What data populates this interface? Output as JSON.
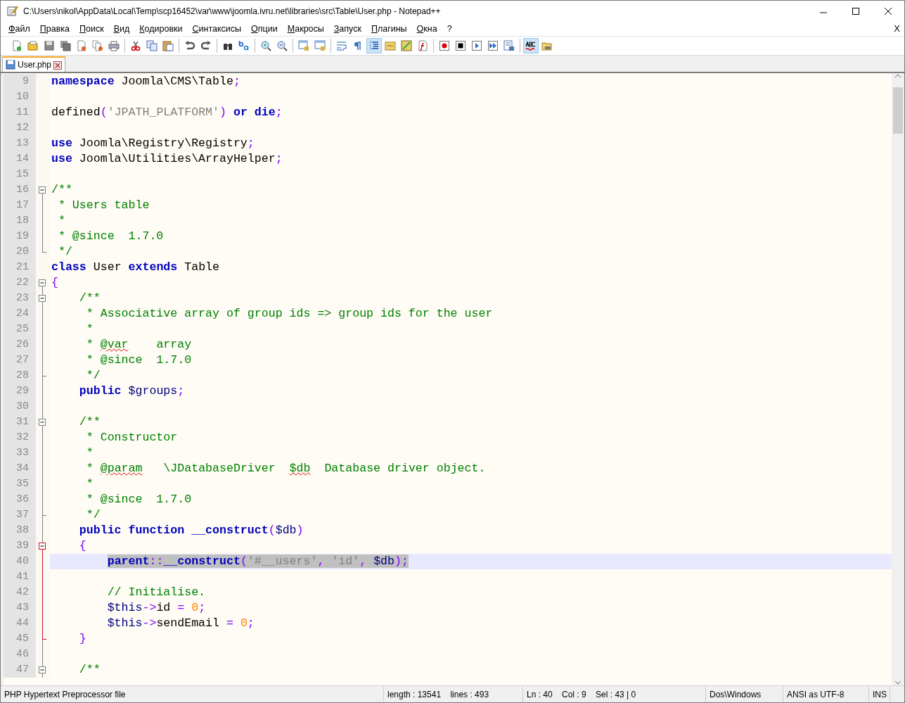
{
  "window": {
    "title": "C:\\Users\\nikol\\AppData\\Local\\Temp\\scp16452\\var\\www\\joomla.ivru.net\\libraries\\src\\Table\\User.php - Notepad++"
  },
  "menu": [
    "Файл",
    "Правка",
    "Поиск",
    "Вид",
    "Кодировки",
    "Синтаксисы",
    "Опции",
    "Макросы",
    "Запуск",
    "Плагины",
    "Окна",
    "?"
  ],
  "menu_close": "X",
  "toolbar": [
    {
      "kind": "new",
      "pressed": false
    },
    {
      "kind": "open",
      "pressed": false
    },
    {
      "kind": "save",
      "pressed": false
    },
    {
      "kind": "save-all",
      "pressed": false
    },
    {
      "kind": "close",
      "pressed": false
    },
    {
      "kind": "close-all",
      "pressed": false
    },
    {
      "kind": "print",
      "pressed": false
    },
    {
      "kind": "separator"
    },
    {
      "kind": "cut",
      "pressed": false
    },
    {
      "kind": "copy",
      "pressed": false
    },
    {
      "kind": "paste",
      "pressed": false
    },
    {
      "kind": "separator"
    },
    {
      "kind": "undo",
      "pressed": false
    },
    {
      "kind": "redo",
      "pressed": false
    },
    {
      "kind": "separator"
    },
    {
      "kind": "find",
      "pressed": false
    },
    {
      "kind": "replace",
      "pressed": false
    },
    {
      "kind": "separator"
    },
    {
      "kind": "zoom-in",
      "pressed": false
    },
    {
      "kind": "zoom-out",
      "pressed": false
    },
    {
      "kind": "separator"
    },
    {
      "kind": "sync-vertical",
      "pressed": false
    },
    {
      "kind": "sync-horizontal",
      "pressed": false
    },
    {
      "kind": "separator"
    },
    {
      "kind": "word-wrap",
      "pressed": false
    },
    {
      "kind": "show-symbols",
      "pressed": false
    },
    {
      "kind": "indent-guide",
      "pressed": true
    },
    {
      "kind": "language",
      "pressed": false
    },
    {
      "kind": "document-map",
      "pressed": false
    },
    {
      "kind": "function-list",
      "pressed": false
    },
    {
      "kind": "separator"
    },
    {
      "kind": "record",
      "pressed": false
    },
    {
      "kind": "stop",
      "pressed": false
    },
    {
      "kind": "play",
      "pressed": false
    },
    {
      "kind": "play-multiple",
      "pressed": false
    },
    {
      "kind": "save-macro",
      "pressed": false
    },
    {
      "kind": "separator"
    },
    {
      "kind": "spellcheck",
      "pressed": true
    },
    {
      "kind": "folder",
      "pressed": false
    }
  ],
  "tabs": [
    {
      "label": "User.php",
      "selected": true
    }
  ],
  "code": {
    "lines": [
      {
        "number": "9",
        "fold_start": false,
        "fold_end": false,
        "current": false,
        "selected": false,
        "tokens": [
          {
            "kind": "kw",
            "text": "namespace"
          },
          {
            "kind": "text",
            "text": " Joomla\\CMS\\Table"
          },
          {
            "kind": "op",
            "text": ";"
          }
        ]
      },
      {
        "number": "10",
        "fold_start": false,
        "fold_end": false,
        "current": false,
        "selected": false
      },
      {
        "number": "11",
        "fold_start": false,
        "fold_end": false,
        "current": false,
        "selected": false,
        "tokens": [
          {
            "kind": "text",
            "text": "defined"
          },
          {
            "kind": "op",
            "text": "("
          },
          {
            "kind": "str",
            "text": "'JPATH_PLATFORM'"
          },
          {
            "kind": "op",
            "text": ") "
          },
          {
            "kind": "kw",
            "text": "or "
          },
          {
            "kind": "kw",
            "text": "die"
          },
          {
            "kind": "op",
            "text": ";"
          }
        ]
      },
      {
        "number": "12",
        "fold_start": false,
        "fold_end": false,
        "current": false,
        "selected": false
      },
      {
        "number": "13",
        "fold_start": false,
        "fold_end": false,
        "current": false,
        "selected": false,
        "tokens": [
          {
            "kind": "kw",
            "text": "use"
          },
          {
            "kind": "text",
            "text": " Joomla\\Registry\\Registry"
          },
          {
            "kind": "op",
            "text": ";"
          }
        ]
      },
      {
        "number": "14",
        "fold_start": false,
        "fold_end": false,
        "current": false,
        "selected": false,
        "tokens": [
          {
            "kind": "kw",
            "text": "use"
          },
          {
            "kind": "text",
            "text": " Joomla\\Utilities\\ArrayHelper"
          },
          {
            "kind": "op",
            "text": ";"
          }
        ]
      },
      {
        "number": "15",
        "fold_start": false,
        "fold_end": false,
        "current": false,
        "selected": false
      },
      {
        "number": "16",
        "fold_start": true,
        "fold_end": false,
        "current": false,
        "selected": false,
        "tokens": [
          {
            "kind": "com",
            "text": "/**"
          }
        ]
      },
      {
        "number": "17",
        "fold_start": false,
        "fold_end": false,
        "current": false,
        "selected": false,
        "tokens": [
          {
            "kind": "com",
            "text": " * Users table"
          }
        ]
      },
      {
        "number": "18",
        "fold_start": false,
        "fold_end": false,
        "current": false,
        "selected": false,
        "tokens": [
          {
            "kind": "com",
            "text": " *"
          }
        ]
      },
      {
        "number": "19",
        "fold_start": false,
        "fold_end": false,
        "current": false,
        "selected": false,
        "tokens": [
          {
            "kind": "com",
            "text": " * @since  1.7.0"
          }
        ]
      },
      {
        "number": "20",
        "fold_start": false,
        "fold_end": true,
        "current": false,
        "selected": false,
        "tokens": [
          {
            "kind": "com",
            "text": " */"
          }
        ]
      },
      {
        "number": "21",
        "fold_start": false,
        "fold_end": false,
        "current": false,
        "selected": false,
        "tokens": [
          {
            "kind": "kw",
            "text": "class"
          },
          {
            "kind": "text",
            "text": " User "
          },
          {
            "kind": "kw",
            "text": "extends"
          },
          {
            "kind": "text",
            "text": " Table"
          }
        ]
      },
      {
        "number": "22",
        "fold_start": true,
        "fold_end": false,
        "current": false,
        "selected": false,
        "tokens": [
          {
            "kind": "op",
            "text": "{"
          }
        ]
      },
      {
        "number": "23",
        "fold_start": true,
        "fold_end": false,
        "current": false,
        "selected": false,
        "tokens": [
          {
            "kind": "com",
            "text": "    /**"
          }
        ]
      },
      {
        "number": "24",
        "fold_start": false,
        "fold_end": false,
        "current": false,
        "selected": false,
        "tokens": [
          {
            "kind": "com",
            "text": "     * Associative array of group ids => group ids for the user"
          }
        ]
      },
      {
        "number": "25",
        "fold_start": false,
        "fold_end": false,
        "current": false,
        "selected": false,
        "tokens": [
          {
            "kind": "com",
            "text": "     *"
          }
        ]
      },
      {
        "number": "26",
        "fold_start": false,
        "fold_end": false,
        "current": false,
        "selected": false,
        "tokens": [
          {
            "kind": "com",
            "text": "     * "
          },
          {
            "kind": "err",
            "text": "@var"
          },
          {
            "kind": "com",
            "text": "    array"
          }
        ]
      },
      {
        "number": "27",
        "fold_start": false,
        "fold_end": false,
        "current": false,
        "selected": false,
        "tokens": [
          {
            "kind": "com",
            "text": "     * @since  1.7.0"
          }
        ]
      },
      {
        "number": "28",
        "fold_start": false,
        "fold_end": true,
        "current": false,
        "selected": false,
        "tokens": [
          {
            "kind": "com",
            "text": "     */"
          }
        ]
      },
      {
        "number": "29",
        "fold_start": false,
        "fold_end": false,
        "current": false,
        "selected": false,
        "tokens": [
          {
            "kind": "kw",
            "text": "    public "
          },
          {
            "kind": "var",
            "text": "$groups"
          },
          {
            "kind": "op",
            "text": ";"
          }
        ]
      },
      {
        "number": "30",
        "fold_start": false,
        "fold_end": false,
        "current": false,
        "selected": false
      },
      {
        "number": "31",
        "fold_start": true,
        "fold_end": false,
        "current": false,
        "selected": false,
        "tokens": [
          {
            "kind": "com",
            "text": "    /**"
          }
        ]
      },
      {
        "number": "32",
        "fold_start": false,
        "fold_end": false,
        "current": false,
        "selected": false,
        "tokens": [
          {
            "kind": "com",
            "text": "     * Constructor"
          }
        ]
      },
      {
        "number": "33",
        "fold_start": false,
        "fold_end": false,
        "current": false,
        "selected": false,
        "tokens": [
          {
            "kind": "com",
            "text": "     *"
          }
        ]
      },
      {
        "number": "34",
        "fold_start": false,
        "fold_end": false,
        "current": false,
        "selected": false,
        "tokens": [
          {
            "kind": "com",
            "text": "     * "
          },
          {
            "kind": "err",
            "text": "@param"
          },
          {
            "kind": "com",
            "text": "   \\JDatabaseDriver  "
          },
          {
            "kind": "err",
            "text": "$db"
          },
          {
            "kind": "com",
            "text": "  Database driver object."
          }
        ]
      },
      {
        "number": "35",
        "fold_start": false,
        "fold_end": false,
        "current": false,
        "selected": false,
        "tokens": [
          {
            "kind": "com",
            "text": "     *"
          }
        ]
      },
      {
        "number": "36",
        "fold_start": false,
        "fold_end": false,
        "current": false,
        "selected": false,
        "tokens": [
          {
            "kind": "com",
            "text": "     * @since  1.7.0"
          }
        ]
      },
      {
        "number": "37",
        "fold_start": false,
        "fold_end": true,
        "current": false,
        "selected": false,
        "tokens": [
          {
            "kind": "com",
            "text": "     */"
          }
        ]
      },
      {
        "number": "38",
        "fold_start": false,
        "fold_end": false,
        "current": false,
        "selected": false,
        "tokens": [
          {
            "kind": "kw",
            "text": "    public function __construct"
          },
          {
            "kind": "op",
            "text": "("
          },
          {
            "kind": "var",
            "text": "$db"
          },
          {
            "kind": "op",
            "text": ")"
          }
        ]
      },
      {
        "number": "39",
        "fold_start": true,
        "fold_end": false,
        "current": false,
        "selected": false,
        "tokens": [
          {
            "kind": "op",
            "text": "    {"
          }
        ]
      },
      {
        "number": "40",
        "fold_start": false,
        "fold_end": false,
        "current": true,
        "selected": true,
        "tokens": [
          {
            "kind": "kw",
            "text": "        parent"
          },
          {
            "kind": "op",
            "text": "::"
          },
          {
            "kind": "kw",
            "text": "__construct"
          },
          {
            "kind": "op",
            "text": "("
          },
          {
            "kind": "str",
            "text": "'#__users'"
          },
          {
            "kind": "op",
            "text": ", "
          },
          {
            "kind": "str",
            "text": "'id'"
          },
          {
            "kind": "op",
            "text": ", "
          },
          {
            "kind": "var",
            "text": "$db"
          },
          {
            "kind": "op",
            "text": ");"
          }
        ]
      },
      {
        "number": "41",
        "fold_start": false,
        "fold_end": false,
        "current": false,
        "selected": false
      },
      {
        "number": "42",
        "fold_start": false,
        "fold_end": false,
        "current": false,
        "selected": false,
        "tokens": [
          {
            "kind": "com",
            "text": "        // Initialise."
          }
        ]
      },
      {
        "number": "43",
        "fold_start": false,
        "fold_end": false,
        "current": false,
        "selected": false,
        "tokens": [
          {
            "kind": "var",
            "text": "        $this"
          },
          {
            "kind": "op",
            "text": "->"
          },
          {
            "kind": "text",
            "text": "id "
          },
          {
            "kind": "op",
            "text": "= "
          },
          {
            "kind": "num",
            "text": "0"
          },
          {
            "kind": "op",
            "text": ";"
          }
        ]
      },
      {
        "number": "44",
        "fold_start": false,
        "fold_end": false,
        "current": false,
        "selected": false,
        "tokens": [
          {
            "kind": "var",
            "text": "        $this"
          },
          {
            "kind": "op",
            "text": "->"
          },
          {
            "kind": "text",
            "text": "sendEmail "
          },
          {
            "kind": "op",
            "text": "= "
          },
          {
            "kind": "num",
            "text": "0"
          },
          {
            "kind": "op",
            "text": ";"
          }
        ]
      },
      {
        "number": "45",
        "fold_start": false,
        "fold_end": true,
        "current": false,
        "selected": false,
        "tokens": [
          {
            "kind": "op",
            "text": "    }"
          }
        ]
      },
      {
        "number": "46",
        "fold_start": false,
        "fold_end": false,
        "current": false,
        "selected": false
      },
      {
        "number": "47",
        "fold_start": true,
        "fold_end": false,
        "current": false,
        "selected": false,
        "tokens": [
          {
            "kind": "com",
            "text": "    /**"
          }
        ]
      }
    ]
  },
  "status_bar": [
    "PHP Hypertext Preprocessor file",
    "length : 13541    lines : 493",
    "Ln : 40    Col : 9    Sel : 43 | 0",
    "Dos\\Windows",
    "ANSI as UTF-8",
    "INS"
  ]
}
